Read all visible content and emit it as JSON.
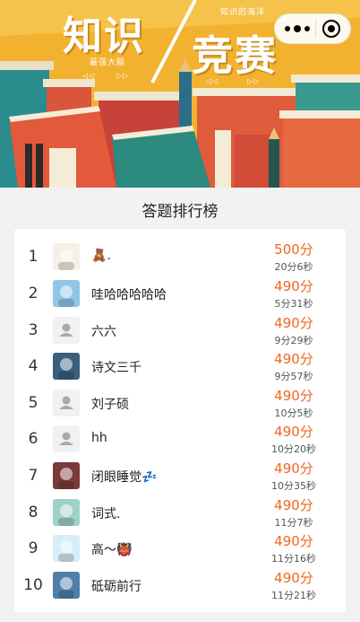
{
  "banner": {
    "title_line1": "知识",
    "title_line2": "竞赛",
    "caption_top": "知识的海洋",
    "caption_left": "最强大脑",
    "ornament_left": "◁◁",
    "ornament_right": "▷▷",
    "colors": {
      "background": "#f2b230",
      "book_red": "#d9553b",
      "book_teal": "#2a8c8c"
    }
  },
  "capsule": {
    "more_icon": "more-dots-icon",
    "close_icon": "target-icon"
  },
  "page": {
    "title": "答题排行榜"
  },
  "ranking": [
    {
      "rank": "1",
      "name": "🧸.",
      "score": "500分",
      "time": "20分6秒",
      "avatar": "cartoon-kids"
    },
    {
      "rank": "2",
      "name": "哇哈哈哈哈哈",
      "score": "490分",
      "time": "5分31秒",
      "avatar": "cartoon-cat"
    },
    {
      "rank": "3",
      "name": "六六",
      "score": "490分",
      "time": "9分29秒",
      "avatar": "default"
    },
    {
      "rank": "4",
      "name": "诗文三千",
      "score": "490分",
      "time": "9分57秒",
      "avatar": "anime-character"
    },
    {
      "rank": "5",
      "name": "刘子硕",
      "score": "490分",
      "time": "10分5秒",
      "avatar": "default"
    },
    {
      "rank": "6",
      "name": "hh",
      "score": "490分",
      "time": "10分20秒",
      "avatar": "default"
    },
    {
      "rank": "7",
      "name": "闭眼睡觉💤",
      "score": "490分",
      "time": "10分35秒",
      "avatar": "sunset-photo"
    },
    {
      "rank": "8",
      "name": "词式.",
      "score": "490分",
      "time": "11分7秒",
      "avatar": "cartoon-boy"
    },
    {
      "rank": "9",
      "name": "高～👹",
      "score": "490分",
      "time": "11分16秒",
      "avatar": "blue-seal"
    },
    {
      "rank": "10",
      "name": "砥砺前行",
      "score": "490分",
      "time": "11分21秒",
      "avatar": "landscape-photo"
    }
  ],
  "colors": {
    "score": "#f0661e",
    "background": "#f2f2f2",
    "card": "#ffffff"
  }
}
